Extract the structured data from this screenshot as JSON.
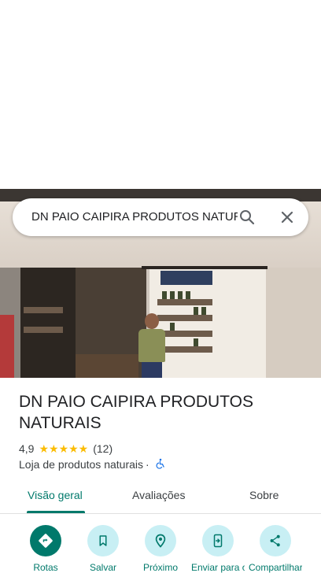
{
  "search": {
    "query": "DN PAIO CAIPIRA PRODUTOS NATURAIS"
  },
  "place": {
    "name": "DN PAIO CAIPIRA PRODUTOS NATURAIS",
    "rating": "4,9",
    "stars": "★★★★★",
    "review_count": "(12)",
    "category": "Loja de produtos naturais",
    "separator": "·"
  },
  "tabs": [
    {
      "label": "Visão geral",
      "active": true
    },
    {
      "label": "Avaliações",
      "active": false
    },
    {
      "label": "Sobre",
      "active": false
    }
  ],
  "actions": [
    {
      "label": "Rotas",
      "icon": "directions-icon"
    },
    {
      "label": "Salvar",
      "icon": "bookmark-icon"
    },
    {
      "label": "Próximo",
      "icon": "nearby-icon"
    },
    {
      "label": "Enviar para o smartphone",
      "icon": "send-to-phone-icon"
    },
    {
      "label": "Compartilhar",
      "icon": "share-icon"
    }
  ],
  "colors": {
    "accent": "#00796b",
    "action_bg": "#c8eff4",
    "star": "#fbbc04",
    "accessibility": "#1a73e8"
  }
}
